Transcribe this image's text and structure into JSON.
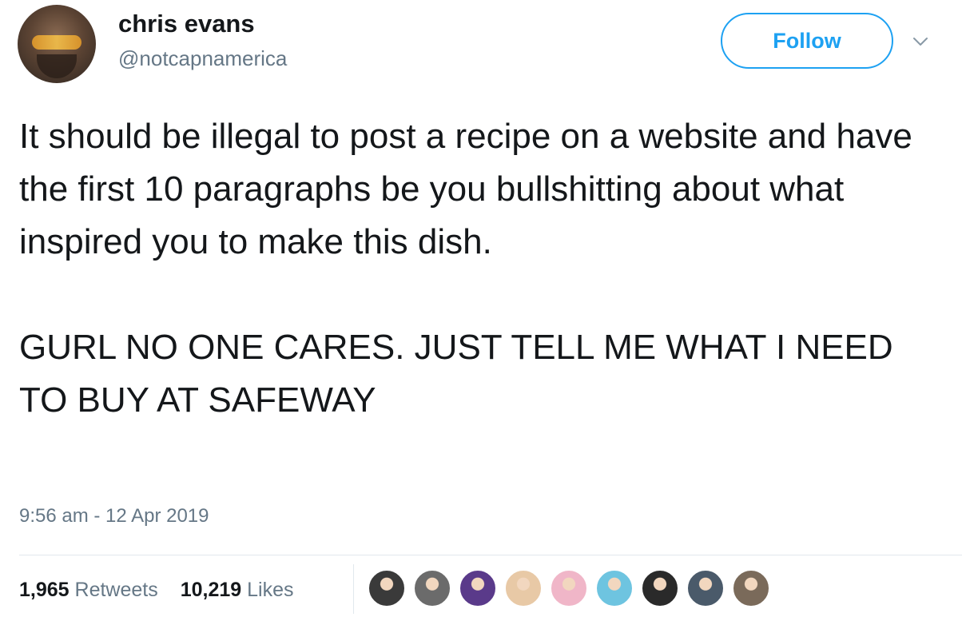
{
  "user": {
    "display_name": "chris evans",
    "handle": "@notcapnamerica"
  },
  "follow_label": "Follow",
  "tweet": {
    "paragraph_1": "It should be illegal to post a recipe on a website and have the first 10 paragraphs be you bullshitting about what inspired you to make this dish.",
    "paragraph_2": "GURL NO ONE CARES.  JUST TELL ME WHAT I NEED TO BUY AT SAFEWAY",
    "timestamp": "9:56 am - 12 Apr 2019"
  },
  "stats": {
    "retweets_count": "1,965",
    "retweets_label": "Retweets",
    "likes_count": "10,219",
    "likes_label": "Likes"
  },
  "colors": {
    "accent": "#1da1f2",
    "secondary_text": "#657786",
    "primary_text": "#14171a",
    "divider": "#e1e8ed"
  },
  "icons": {
    "menu": "chevron-down-icon"
  },
  "liker_avatar_colors": [
    "#3a3a3a",
    "#6b6b6b",
    "#5a3a8a",
    "#e8c9a6",
    "#f0b6c8",
    "#6ec4e0",
    "#2a2a2a",
    "#4a5a6a",
    "#7a6a5a"
  ]
}
